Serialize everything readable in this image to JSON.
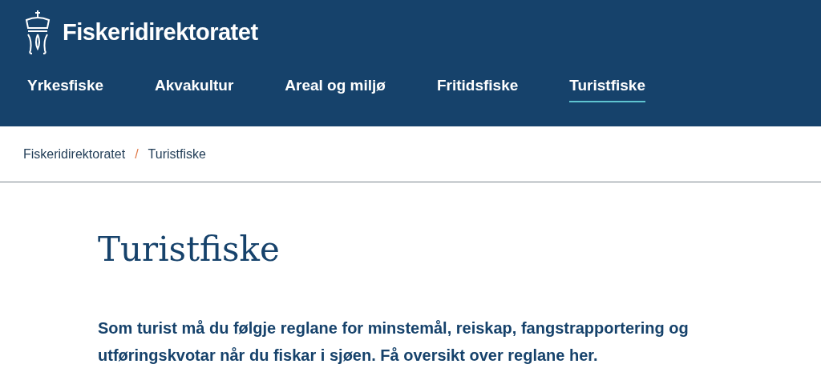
{
  "header": {
    "site_name": "Fiskeridirektoratet",
    "nav": [
      {
        "label": "Yrkesfiske",
        "selected": false
      },
      {
        "label": "Akvakultur",
        "selected": false
      },
      {
        "label": "Areal og miljø",
        "selected": false
      },
      {
        "label": "Fritidsfiske",
        "selected": false
      },
      {
        "label": "Turistfiske",
        "selected": true
      }
    ]
  },
  "breadcrumb": {
    "items": [
      "Fiskeridirektoratet",
      "Turistfiske"
    ],
    "separator": "/"
  },
  "page": {
    "title": "Turistfiske",
    "intro": "Som turist må du følgje reglane for minstemål, reiskap, fangstrapportering og utføringskvotar når du fiskar i sjøen. Få oversikt over reglane her."
  }
}
